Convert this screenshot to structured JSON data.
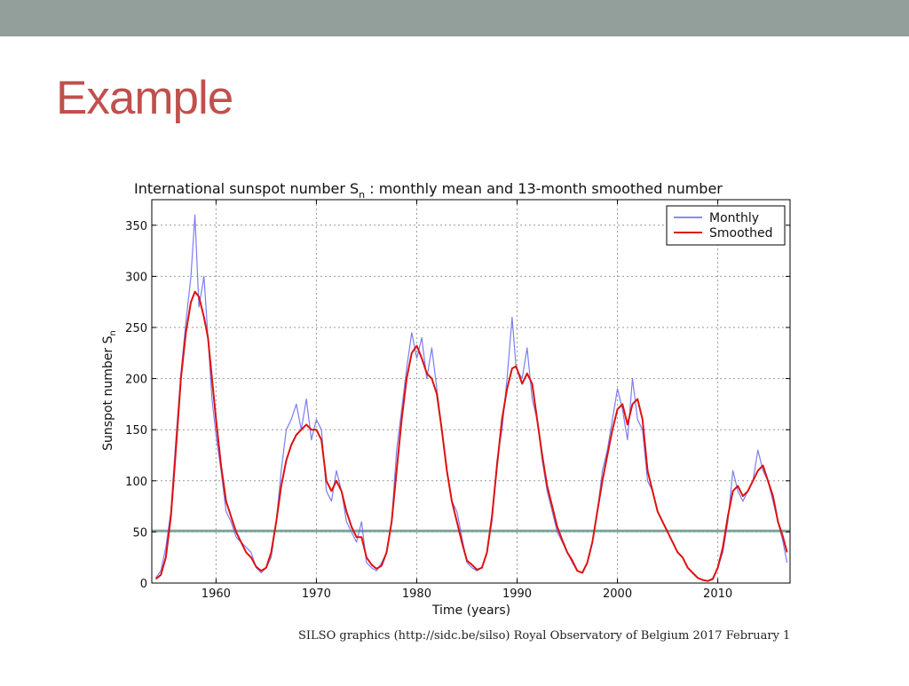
{
  "slide": {
    "title": "Example",
    "title_color": "#c0504d",
    "bar_color": "#929f9a"
  },
  "credit": "SILSO graphics (http://sidc.be/silso)  Royal Observatory of Belgium  2017 February 1",
  "chart_data": {
    "type": "line",
    "title_main": "International sunspot number S",
    "title_sub": "n",
    "title_rest": " : monthly mean and 13-month smoothed number",
    "xlabel": "Time (years)",
    "ylabel_main": "Sunspot number S",
    "ylabel_sub": "n",
    "xlim": [
      1953.6,
      2017.2
    ],
    "ylim": [
      0,
      375
    ],
    "xticks": [
      1960,
      1970,
      1980,
      1990,
      2000,
      2010
    ],
    "yticks": [
      0,
      50,
      100,
      150,
      200,
      250,
      300,
      350
    ],
    "grid": true,
    "legend_position": "top-right",
    "reference_line": {
      "y": 51,
      "color": "#7fa59b"
    },
    "series": [
      {
        "name": "Monthly",
        "color": "#6666ee",
        "points": [
          [
            1954.0,
            5
          ],
          [
            1954.5,
            12
          ],
          [
            1955.0,
            35
          ],
          [
            1955.5,
            70
          ],
          [
            1956.0,
            140
          ],
          [
            1956.5,
            205
          ],
          [
            1957.0,
            255
          ],
          [
            1957.5,
            300
          ],
          [
            1957.9,
            360
          ],
          [
            1958.3,
            270
          ],
          [
            1958.8,
            300
          ],
          [
            1959.2,
            240
          ],
          [
            1959.6,
            180
          ],
          [
            1960.0,
            145
          ],
          [
            1960.5,
            110
          ],
          [
            1961.0,
            70
          ],
          [
            1961.5,
            60
          ],
          [
            1962.0,
            45
          ],
          [
            1962.5,
            40
          ],
          [
            1963.0,
            35
          ],
          [
            1963.5,
            30
          ],
          [
            1964.0,
            15
          ],
          [
            1964.5,
            10
          ],
          [
            1965.0,
            15
          ],
          [
            1965.5,
            25
          ],
          [
            1966.0,
            60
          ],
          [
            1966.5,
            110
          ],
          [
            1967.0,
            150
          ],
          [
            1967.5,
            160
          ],
          [
            1968.0,
            175
          ],
          [
            1968.5,
            150
          ],
          [
            1969.0,
            180
          ],
          [
            1969.5,
            140
          ],
          [
            1970.0,
            160
          ],
          [
            1970.5,
            150
          ],
          [
            1971.0,
            90
          ],
          [
            1971.5,
            80
          ],
          [
            1972.0,
            110
          ],
          [
            1972.5,
            90
          ],
          [
            1973.0,
            60
          ],
          [
            1973.5,
            50
          ],
          [
            1974.0,
            40
          ],
          [
            1974.5,
            60
          ],
          [
            1975.0,
            20
          ],
          [
            1975.5,
            15
          ],
          [
            1976.0,
            12
          ],
          [
            1976.5,
            20
          ],
          [
            1977.0,
            30
          ],
          [
            1977.5,
            60
          ],
          [
            1978.0,
            130
          ],
          [
            1978.5,
            170
          ],
          [
            1979.0,
            210
          ],
          [
            1979.5,
            245
          ],
          [
            1980.0,
            220
          ],
          [
            1980.5,
            240
          ],
          [
            1981.0,
            200
          ],
          [
            1981.5,
            230
          ],
          [
            1982.0,
            190
          ],
          [
            1982.5,
            150
          ],
          [
            1983.0,
            110
          ],
          [
            1983.5,
            80
          ],
          [
            1984.0,
            70
          ],
          [
            1984.5,
            45
          ],
          [
            1985.0,
            20
          ],
          [
            1985.5,
            15
          ],
          [
            1986.0,
            12
          ],
          [
            1986.5,
            15
          ],
          [
            1987.0,
            30
          ],
          [
            1987.5,
            60
          ],
          [
            1988.0,
            120
          ],
          [
            1988.5,
            150
          ],
          [
            1989.0,
            200
          ],
          [
            1989.5,
            260
          ],
          [
            1989.9,
            210
          ],
          [
            1990.5,
            200
          ],
          [
            1991.0,
            230
          ],
          [
            1991.5,
            180
          ],
          [
            1992.0,
            160
          ],
          [
            1992.5,
            120
          ],
          [
            1993.0,
            90
          ],
          [
            1993.5,
            70
          ],
          [
            1994.0,
            50
          ],
          [
            1994.5,
            40
          ],
          [
            1995.0,
            30
          ],
          [
            1995.5,
            20
          ],
          [
            1996.0,
            12
          ],
          [
            1996.5,
            10
          ],
          [
            1997.0,
            20
          ],
          [
            1997.5,
            40
          ],
          [
            1998.0,
            70
          ],
          [
            1998.5,
            110
          ],
          [
            1999.0,
            130
          ],
          [
            1999.5,
            160
          ],
          [
            2000.0,
            190
          ],
          [
            2000.5,
            170
          ],
          [
            2001.0,
            140
          ],
          [
            2001.5,
            200
          ],
          [
            2002.0,
            160
          ],
          [
            2002.5,
            150
          ],
          [
            2003.0,
            100
          ],
          [
            2003.5,
            90
          ],
          [
            2004.0,
            70
          ],
          [
            2004.5,
            60
          ],
          [
            2005.0,
            50
          ],
          [
            2005.5,
            40
          ],
          [
            2006.0,
            30
          ],
          [
            2006.5,
            25
          ],
          [
            2007.0,
            15
          ],
          [
            2007.5,
            10
          ],
          [
            2008.0,
            5
          ],
          [
            2008.5,
            3
          ],
          [
            2009.0,
            2
          ],
          [
            2009.5,
            5
          ],
          [
            2010.0,
            15
          ],
          [
            2010.5,
            30
          ],
          [
            2011.0,
            60
          ],
          [
            2011.5,
            110
          ],
          [
            2012.0,
            90
          ],
          [
            2012.5,
            80
          ],
          [
            2013.0,
            90
          ],
          [
            2013.5,
            100
          ],
          [
            2014.0,
            130
          ],
          [
            2014.5,
            110
          ],
          [
            2015.0,
            100
          ],
          [
            2015.5,
            80
          ],
          [
            2016.0,
            60
          ],
          [
            2016.5,
            40
          ],
          [
            2016.9,
            20
          ]
        ]
      },
      {
        "name": "Smoothed",
        "color": "#dd1111",
        "points": [
          [
            1954.0,
            4
          ],
          [
            1954.5,
            8
          ],
          [
            1955.0,
            25
          ],
          [
            1955.5,
            65
          ],
          [
            1956.0,
            130
          ],
          [
            1956.5,
            200
          ],
          [
            1957.0,
            245
          ],
          [
            1957.5,
            275
          ],
          [
            1957.9,
            285
          ],
          [
            1958.3,
            280
          ],
          [
            1958.8,
            260
          ],
          [
            1959.2,
            240
          ],
          [
            1959.6,
            200
          ],
          [
            1960.0,
            160
          ],
          [
            1960.5,
            115
          ],
          [
            1961.0,
            80
          ],
          [
            1961.5,
            65
          ],
          [
            1962.0,
            50
          ],
          [
            1962.5,
            40
          ],
          [
            1963.0,
            30
          ],
          [
            1963.5,
            25
          ],
          [
            1964.0,
            16
          ],
          [
            1964.5,
            12
          ],
          [
            1965.0,
            15
          ],
          [
            1965.5,
            30
          ],
          [
            1966.0,
            60
          ],
          [
            1966.5,
            95
          ],
          [
            1967.0,
            120
          ],
          [
            1967.5,
            135
          ],
          [
            1968.0,
            145
          ],
          [
            1968.5,
            150
          ],
          [
            1969.0,
            155
          ],
          [
            1969.5,
            150
          ],
          [
            1970.0,
            150
          ],
          [
            1970.5,
            140
          ],
          [
            1971.0,
            100
          ],
          [
            1971.5,
            90
          ],
          [
            1972.0,
            100
          ],
          [
            1972.5,
            90
          ],
          [
            1973.0,
            70
          ],
          [
            1973.5,
            55
          ],
          [
            1974.0,
            45
          ],
          [
            1974.5,
            45
          ],
          [
            1975.0,
            25
          ],
          [
            1975.5,
            18
          ],
          [
            1976.0,
            14
          ],
          [
            1976.5,
            17
          ],
          [
            1977.0,
            30
          ],
          [
            1977.5,
            60
          ],
          [
            1978.0,
            110
          ],
          [
            1978.5,
            160
          ],
          [
            1979.0,
            200
          ],
          [
            1979.5,
            225
          ],
          [
            1980.0,
            232
          ],
          [
            1980.5,
            220
          ],
          [
            1981.0,
            205
          ],
          [
            1981.5,
            200
          ],
          [
            1982.0,
            185
          ],
          [
            1982.5,
            150
          ],
          [
            1983.0,
            110
          ],
          [
            1983.5,
            80
          ],
          [
            1984.0,
            60
          ],
          [
            1984.5,
            40
          ],
          [
            1985.0,
            22
          ],
          [
            1985.5,
            18
          ],
          [
            1986.0,
            13
          ],
          [
            1986.5,
            15
          ],
          [
            1987.0,
            30
          ],
          [
            1987.5,
            65
          ],
          [
            1988.0,
            115
          ],
          [
            1988.5,
            160
          ],
          [
            1989.0,
            190
          ],
          [
            1989.5,
            210
          ],
          [
            1989.9,
            212
          ],
          [
            1990.5,
            195
          ],
          [
            1991.0,
            205
          ],
          [
            1991.5,
            195
          ],
          [
            1992.0,
            160
          ],
          [
            1992.5,
            125
          ],
          [
            1993.0,
            95
          ],
          [
            1993.5,
            75
          ],
          [
            1994.0,
            55
          ],
          [
            1994.5,
            42
          ],
          [
            1995.0,
            30
          ],
          [
            1995.5,
            22
          ],
          [
            1996.0,
            12
          ],
          [
            1996.5,
            10
          ],
          [
            1997.0,
            20
          ],
          [
            1997.5,
            40
          ],
          [
            1998.0,
            70
          ],
          [
            1998.5,
            100
          ],
          [
            1999.0,
            125
          ],
          [
            1999.5,
            150
          ],
          [
            2000.0,
            170
          ],
          [
            2000.5,
            175
          ],
          [
            2001.0,
            155
          ],
          [
            2001.5,
            175
          ],
          [
            2002.0,
            180
          ],
          [
            2002.5,
            160
          ],
          [
            2003.0,
            110
          ],
          [
            2003.5,
            90
          ],
          [
            2004.0,
            70
          ],
          [
            2004.5,
            60
          ],
          [
            2005.0,
            50
          ],
          [
            2005.5,
            40
          ],
          [
            2006.0,
            30
          ],
          [
            2006.5,
            25
          ],
          [
            2007.0,
            15
          ],
          [
            2007.5,
            10
          ],
          [
            2008.0,
            5
          ],
          [
            2008.5,
            3
          ],
          [
            2009.0,
            2
          ],
          [
            2009.5,
            4
          ],
          [
            2010.0,
            15
          ],
          [
            2010.5,
            35
          ],
          [
            2011.0,
            65
          ],
          [
            2011.5,
            90
          ],
          [
            2012.0,
            95
          ],
          [
            2012.5,
            85
          ],
          [
            2013.0,
            90
          ],
          [
            2013.5,
            100
          ],
          [
            2014.0,
            110
          ],
          [
            2014.5,
            115
          ],
          [
            2015.0,
            100
          ],
          [
            2015.5,
            85
          ],
          [
            2016.0,
            60
          ],
          [
            2016.5,
            45
          ],
          [
            2016.9,
            30
          ]
        ]
      }
    ]
  }
}
